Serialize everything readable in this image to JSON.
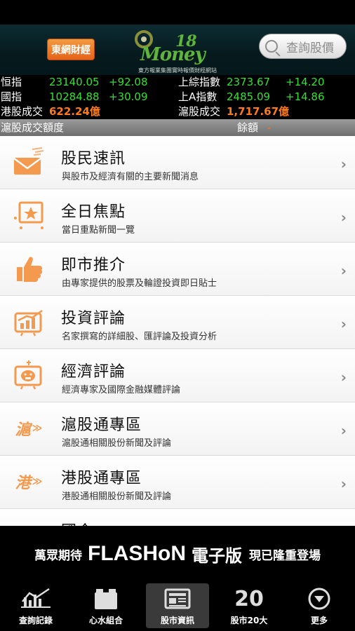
{
  "header": {
    "brand_button": "東網財經",
    "logo_text": "Money",
    "logo_number": "18",
    "logo_tagline": "東方報業集團實時報價財經網站",
    "search_placeholder": "查詢股價"
  },
  "ticker": {
    "rows": [
      {
        "l_label": "恒指",
        "l_value": "23140.05",
        "l_change": "+92.08",
        "r_label": "上綜指數",
        "r_value": "2373.67",
        "r_change": "+14.20"
      },
      {
        "l_label": "國指",
        "l_value": "10284.88",
        "l_change": "+30.09",
        "r_label": "上A指數",
        "r_value": "2485.09",
        "r_change": "+14.86"
      }
    ],
    "turnover": {
      "l_label": "港股成交",
      "l_value": "622.24億",
      "r_label": "滬股成交",
      "r_value": "1,717.67億"
    }
  },
  "quota": {
    "label": "滬股成交額度",
    "balance_label": "餘額",
    "balance_value": "-"
  },
  "menu": [
    {
      "title": "股民速訊",
      "subtitle": "與股市及經濟有關的主要新聞消息",
      "icon": "envelope-icon"
    },
    {
      "title": "全日焦點",
      "subtitle": "當日重點新聞一覽",
      "icon": "star-board-icon"
    },
    {
      "title": "即市推介",
      "subtitle": "由專家提供的股票及輪證投資即日貼士",
      "icon": "thumbs-up-icon"
    },
    {
      "title": "投資評論",
      "subtitle": "名家撰寫的詳細股、匯評論及投資分析",
      "icon": "chart-board-icon"
    },
    {
      "title": "經濟評論",
      "subtitle": "經濟專家及國際金融媒體評論",
      "icon": "piggy-bank-icon"
    },
    {
      "title": "滬股通專區",
      "subtitle": "滬股通相關股份新聞及評論",
      "icon": "hu-glyph-icon",
      "glyph": "滬"
    },
    {
      "title": "港股通專區",
      "subtitle": "港股通相關股份新聞及評論",
      "icon": "gang-glyph-icon",
      "glyph": "港"
    },
    {
      "title": "國企",
      "subtitle": "",
      "icon": "partial-icon"
    }
  ],
  "banner": {
    "prefix": "萬眾期待",
    "brand": "FLASHoN",
    "product": "電子版",
    "suffix": "現已隆重登場"
  },
  "tabs": [
    {
      "label": "查詢記錄",
      "icon": "chart-history-icon"
    },
    {
      "label": "心水組合",
      "icon": "portfolio-icon"
    },
    {
      "label": "股市資訊",
      "icon": "news-icon",
      "active": true
    },
    {
      "label": "股市20大",
      "icon": "top20-icon",
      "number": "20"
    },
    {
      "label": "更多",
      "icon": "more-icon"
    }
  ],
  "colors": {
    "accent_orange": "#ff7a1a",
    "up_green": "#33e033",
    "icon_orange": "#f39a4f"
  }
}
